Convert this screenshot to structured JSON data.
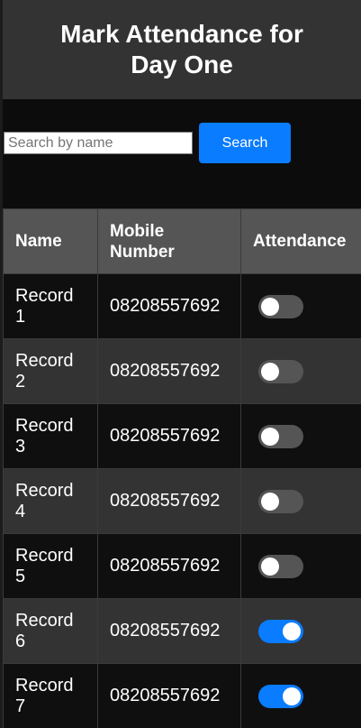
{
  "header": {
    "title": "Mark Attendance for Day One"
  },
  "search": {
    "placeholder": "Search by name",
    "value": "",
    "button_label": "Search"
  },
  "table": {
    "columns": [
      "Name",
      "Mobile Number",
      "Attendance"
    ],
    "rows": [
      {
        "name": "Record 1",
        "mobile": "08208557692",
        "present": false
      },
      {
        "name": "Record 2",
        "mobile": "08208557692",
        "present": false
      },
      {
        "name": "Record 3",
        "mobile": "08208557692",
        "present": false
      },
      {
        "name": "Record 4",
        "mobile": "08208557692",
        "present": false
      },
      {
        "name": "Record 5",
        "mobile": "08208557692",
        "present": false
      },
      {
        "name": "Record 6",
        "mobile": "08208557692",
        "present": true
      },
      {
        "name": "Record 7",
        "mobile": "08208557692",
        "present": true
      }
    ]
  },
  "colors": {
    "accent": "#0a7cff",
    "toggle_off": "#555555",
    "header_bg": "#333333"
  }
}
